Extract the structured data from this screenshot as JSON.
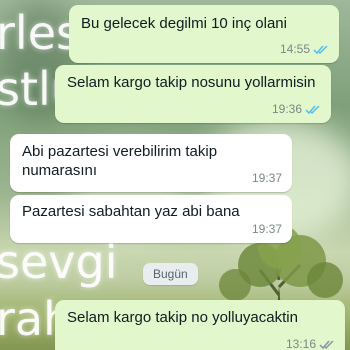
{
  "wallpaper": {
    "text_1": "rles",
    "text_2": "stlu",
    "text_3": "sevgi",
    "text_4": "rah"
  },
  "messages": [
    {
      "direction": "out",
      "text": "Bu gelecek degilmi 10 inç olani",
      "time": "14:55",
      "status": "read"
    },
    {
      "direction": "out",
      "text": "Selam kargo takip nosunu yollarmisin",
      "time": "19:36",
      "status": "read"
    },
    {
      "direction": "in",
      "text": "Abi pazartesi verebilirim takip numarasını",
      "time": "19:37"
    },
    {
      "direction": "in",
      "text": "Pazartesi sabahtan yaz abi bana",
      "time": "19:37"
    },
    {
      "direction": "out",
      "text": "Selam kargo takip no yolluyacaktin",
      "time": "13:16",
      "status": "delivered"
    }
  ],
  "date_separator": "Bugün",
  "colors": {
    "outgoing_bubble": "#e2f7cb",
    "incoming_bubble": "#ffffff",
    "read_ticks": "#53bdeb",
    "delivered_ticks": "#8696a0",
    "timestamp": "#7a8a86"
  },
  "icons": {
    "read_status": "double-check-blue-icon",
    "delivered_status": "double-check-gray-icon"
  }
}
